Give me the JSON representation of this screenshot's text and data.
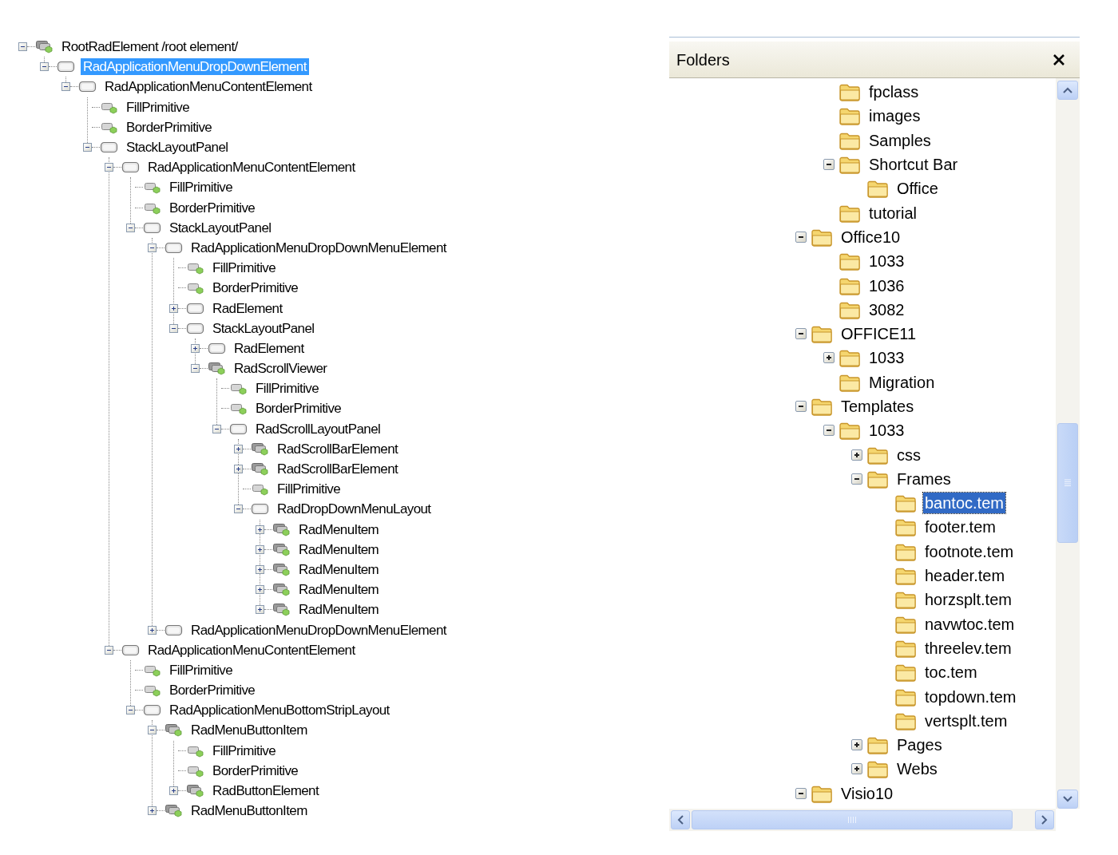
{
  "element_tree": {
    "nodes": [
      {
        "label": "RootRadElement /root element/",
        "kind": "composite",
        "expanded": true,
        "selected": false,
        "children": [
          {
            "label": "RadApplicationMenuDropDownElement",
            "kind": "panel",
            "expanded": true,
            "selected": true,
            "children": [
              {
                "label": "RadApplicationMenuContentElement",
                "kind": "panel",
                "expanded": true,
                "selected": false,
                "children": [
                  {
                    "label": "FillPrimitive",
                    "kind": "primitive",
                    "selected": false
                  },
                  {
                    "label": "BorderPrimitive",
                    "kind": "primitive",
                    "selected": false
                  },
                  {
                    "label": "StackLayoutPanel",
                    "kind": "panel",
                    "expanded": true,
                    "selected": false,
                    "children": [
                      {
                        "label": "RadApplicationMenuContentElement",
                        "kind": "panel",
                        "expanded": true,
                        "selected": false,
                        "children": [
                          {
                            "label": "FillPrimitive",
                            "kind": "primitive",
                            "selected": false
                          },
                          {
                            "label": "BorderPrimitive",
                            "kind": "primitive",
                            "selected": false
                          },
                          {
                            "label": "StackLayoutPanel",
                            "kind": "panel",
                            "expanded": true,
                            "selected": false,
                            "children": [
                              {
                                "label": "RadApplicationMenuDropDownMenuElement",
                                "kind": "panel",
                                "expanded": true,
                                "selected": false,
                                "children": [
                                  {
                                    "label": "FillPrimitive",
                                    "kind": "primitive",
                                    "selected": false
                                  },
                                  {
                                    "label": "BorderPrimitive",
                                    "kind": "primitive",
                                    "selected": false
                                  },
                                  {
                                    "label": "RadElement",
                                    "kind": "panel",
                                    "expanded": false,
                                    "selected": false
                                  },
                                  {
                                    "label": "StackLayoutPanel",
                                    "kind": "panel",
                                    "expanded": true,
                                    "selected": false,
                                    "children": [
                                      {
                                        "label": "RadElement",
                                        "kind": "panel",
                                        "expanded": false,
                                        "selected": false
                                      },
                                      {
                                        "label": "RadScrollViewer",
                                        "kind": "composite",
                                        "expanded": true,
                                        "selected": false,
                                        "children": [
                                          {
                                            "label": "FillPrimitive",
                                            "kind": "primitive",
                                            "selected": false
                                          },
                                          {
                                            "label": "BorderPrimitive",
                                            "kind": "primitive",
                                            "selected": false
                                          },
                                          {
                                            "label": "RadScrollLayoutPanel",
                                            "kind": "panel",
                                            "expanded": true,
                                            "selected": false,
                                            "children": [
                                              {
                                                "label": "RadScrollBarElement",
                                                "kind": "composite",
                                                "expanded": false,
                                                "selected": false
                                              },
                                              {
                                                "label": "RadScrollBarElement",
                                                "kind": "composite",
                                                "expanded": false,
                                                "selected": false
                                              },
                                              {
                                                "label": "FillPrimitive",
                                                "kind": "primitive",
                                                "selected": false
                                              },
                                              {
                                                "label": "RadDropDownMenuLayout",
                                                "kind": "panel",
                                                "expanded": true,
                                                "selected": false,
                                                "children": [
                                                  {
                                                    "label": "RadMenuItem",
                                                    "kind": "composite",
                                                    "expanded": false,
                                                    "selected": false
                                                  },
                                                  {
                                                    "label": "RadMenuItem",
                                                    "kind": "composite",
                                                    "expanded": false,
                                                    "selected": false
                                                  },
                                                  {
                                                    "label": "RadMenuItem",
                                                    "kind": "composite",
                                                    "expanded": false,
                                                    "selected": false
                                                  },
                                                  {
                                                    "label": "RadMenuItem",
                                                    "kind": "composite",
                                                    "expanded": false,
                                                    "selected": false
                                                  },
                                                  {
                                                    "label": "RadMenuItem",
                                                    "kind": "composite",
                                                    "expanded": false,
                                                    "selected": false
                                                  }
                                                ]
                                              }
                                            ]
                                          }
                                        ]
                                      }
                                    ]
                                  }
                                ]
                              },
                              {
                                "label": "RadApplicationMenuDropDownMenuElement",
                                "kind": "panel",
                                "expanded": false,
                                "selected": false
                              }
                            ]
                          }
                        ]
                      },
                      {
                        "label": "RadApplicationMenuContentElement",
                        "kind": "panel",
                        "expanded": true,
                        "selected": false,
                        "children": [
                          {
                            "label": "FillPrimitive",
                            "kind": "primitive",
                            "selected": false
                          },
                          {
                            "label": "BorderPrimitive",
                            "kind": "primitive",
                            "selected": false
                          },
                          {
                            "label": "RadApplicationMenuBottomStripLayout",
                            "kind": "panel",
                            "expanded": true,
                            "selected": false,
                            "children": [
                              {
                                "label": "RadMenuButtonItem",
                                "kind": "composite",
                                "expanded": true,
                                "selected": false,
                                "children": [
                                  {
                                    "label": "FillPrimitive",
                                    "kind": "primitive",
                                    "selected": false
                                  },
                                  {
                                    "label": "BorderPrimitive",
                                    "kind": "primitive",
                                    "selected": false
                                  },
                                  {
                                    "label": "RadButtonElement",
                                    "kind": "composite",
                                    "expanded": false,
                                    "selected": false
                                  }
                                ]
                              },
                              {
                                "label": "RadMenuButtonItem",
                                "kind": "composite",
                                "expanded": false,
                                "selected": false
                              }
                            ]
                          }
                        ]
                      }
                    ]
                  }
                ]
              }
            ]
          }
        ]
      }
    ]
  },
  "folders_panel": {
    "title": "Folders",
    "items_continued_from_above": [
      {
        "label": "fpclass",
        "selected": false
      },
      {
        "label": "images",
        "selected": false
      },
      {
        "label": "Samples",
        "selected": false
      },
      {
        "label": "Shortcut Bar",
        "expanded": true,
        "selected": false,
        "children": [
          {
            "label": "Office",
            "selected": false
          }
        ]
      },
      {
        "label": "tutorial",
        "selected": false
      }
    ],
    "items": [
      {
        "label": "Office10",
        "expanded": true,
        "selected": false,
        "children": [
          {
            "label": "1033",
            "selected": false
          },
          {
            "label": "1036",
            "selected": false
          },
          {
            "label": "3082",
            "selected": false
          }
        ]
      },
      {
        "label": "OFFICE11",
        "expanded": true,
        "selected": false,
        "children": [
          {
            "label": "1033",
            "expanded": false,
            "selected": false
          },
          {
            "label": "Migration",
            "selected": false
          }
        ]
      },
      {
        "label": "Templates",
        "expanded": true,
        "selected": false,
        "children": [
          {
            "label": "1033",
            "expanded": true,
            "selected": false,
            "children": [
              {
                "label": "css",
                "expanded": false,
                "selected": false
              },
              {
                "label": "Frames",
                "expanded": true,
                "selected": false,
                "children": [
                  {
                    "label": "bantoc.tem",
                    "selected": true
                  },
                  {
                    "label": "footer.tem",
                    "selected": false
                  },
                  {
                    "label": "footnote.tem",
                    "selected": false
                  },
                  {
                    "label": "header.tem",
                    "selected": false
                  },
                  {
                    "label": "horzsplt.tem",
                    "selected": false
                  },
                  {
                    "label": "navwtoc.tem",
                    "selected": false
                  },
                  {
                    "label": "threelev.tem",
                    "selected": false
                  },
                  {
                    "label": "toc.tem",
                    "selected": false
                  },
                  {
                    "label": "topdown.tem",
                    "selected": false
                  },
                  {
                    "label": "vertsplt.tem",
                    "selected": false
                  }
                ]
              },
              {
                "label": "Pages",
                "expanded": false,
                "selected": false
              },
              {
                "label": "Webs",
                "expanded": false,
                "selected": false
              }
            ]
          }
        ]
      },
      {
        "label": "Visio10",
        "expanded": true,
        "selected": false
      }
    ]
  }
}
